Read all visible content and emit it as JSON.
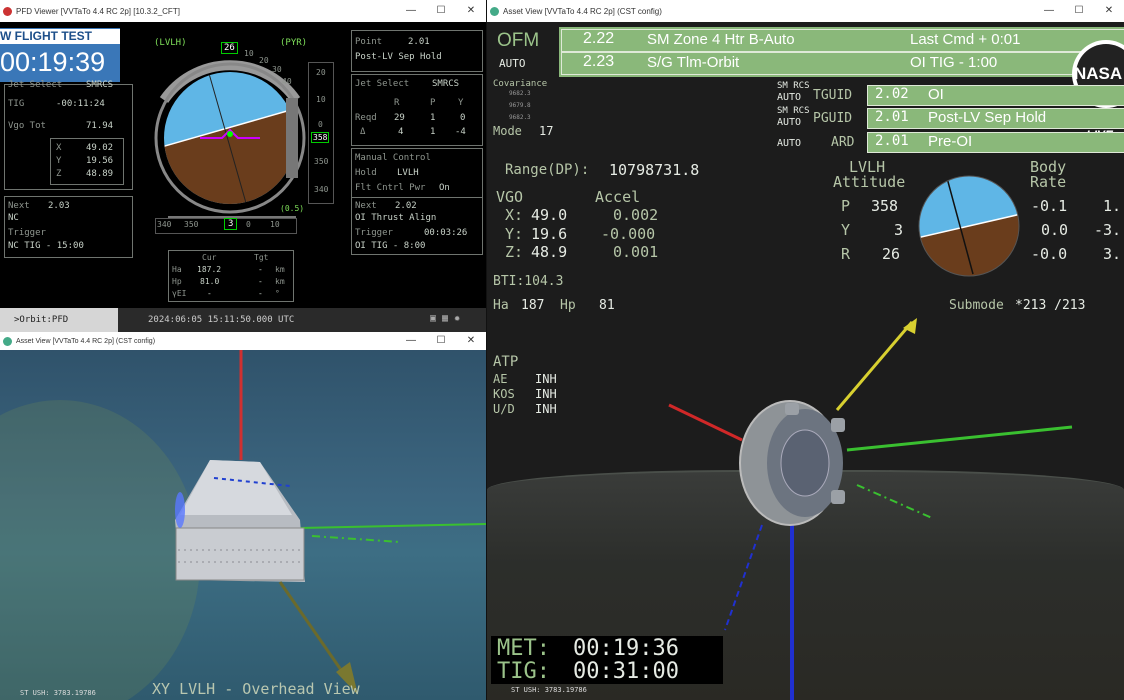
{
  "pfd": {
    "title": "PFD Viewer [VVTaTo 4.4 RC 2p] [10.3.2_CFT]",
    "controls": {
      "min": "—",
      "max": "☐",
      "close": "✕"
    },
    "banner": {
      "label": "W FLIGHT TEST",
      "timer": "00:19:39"
    },
    "left": {
      "jet_select_label": "Jet Select",
      "jet_select_value": "SMRCS",
      "tig_label": "TIG",
      "tig_value": "-00:11:24",
      "vgo_label": "Vgo Tot",
      "vgo_value": "71.94",
      "x_label": "X",
      "x_value": "49.02",
      "y_label": "Y",
      "y_value": "19.56",
      "z_label": "Z",
      "z_value": "48.89",
      "next_label": "Next",
      "next_value": "2.03",
      "next_name": "NC",
      "trigger_label": "Trigger",
      "trigger_value": "NC TIG - 15:00"
    },
    "attitude": {
      "lvlh": "(LVLH)",
      "pyr": "(PYR)",
      "roll_value": "26",
      "pitch_scale": [
        "20",
        "10",
        "0",
        "350",
        "340"
      ],
      "pitch_value": "358",
      "yaw_scale": [
        "340",
        "350",
        "0",
        "10"
      ],
      "yaw_value": "3",
      "roll_scale": [
        "10",
        "20",
        "30",
        "40"
      ],
      "rate_tag": "(0.5)"
    },
    "right": {
      "point_label": "Point",
      "point_value": "2.01",
      "point_name": "Post-LV Sep Hold",
      "jet_select_label": "Jet Select",
      "jet_select_value": "SMRCS",
      "r_label": "R",
      "p_label": "P",
      "y_label": "Y",
      "reqd_label": "Reqd",
      "reqd_r": "29",
      "reqd_p": "1",
      "reqd_y": "0",
      "delta_label": "Δ",
      "delta_r": "4",
      "delta_p": "1",
      "delta_y": "-4",
      "manual_label": "Manual Control",
      "hold_label": "Hold",
      "hold_value": "LVLH",
      "flt_label": "Flt Cntrl Pwr",
      "flt_value": "On",
      "next_label": "Next",
      "next_value": "2.02",
      "next_name": "OI Thrust Align",
      "trigger_label": "Trigger",
      "trigger_value": "00:03:26",
      "trigger_name": "OI TIG - 8:00"
    },
    "orbit": {
      "cur_label": "Cur",
      "tgt_label": "Tgt",
      "ha_label": "Ha",
      "ha_cur": "187.2",
      "ha_tgt": "-",
      "ha_unit": "km",
      "hp_label": "Hp",
      "hp_cur": "81.0",
      "hp_tgt": "-",
      "hp_unit": "km",
      "yei_label": "γEI",
      "yei_cur": "-",
      "yei_tgt": "-",
      "yei_unit": "°"
    },
    "footer": {
      "crumb": ">Orbit:PFD",
      "timestamp": "2024:06:05  15:11:50.000  UTC"
    }
  },
  "asset_left": {
    "title": "Asset View [VVTaTo 4.4 RC 2p] (CST config)",
    "caption": "XY LVLH - Overhead View",
    "st": "ST USH: 3783.19786"
  },
  "asset_right": {
    "title": "Asset View [VVTaTo 4.4 RC 2p] (CST config)",
    "ofm": "OFM",
    "auto": "AUTO",
    "rows": [
      {
        "code": "2.22",
        "name": "SM Zone 4 Htr B-Auto",
        "extra": "Last Cmd + 0:01"
      },
      {
        "code": "2.23",
        "name": "S/G Tlm-Orbit",
        "extra": "OI TIG - 1:00"
      }
    ],
    "covariance": "Covariance",
    "cov_vals": [
      "9682.3",
      "9679.8",
      "9682.3"
    ],
    "mode_label": "Mode",
    "mode_value": "17",
    "guid": [
      {
        "prefix": "SM RCS",
        "auto": "AUTO",
        "key": "TGUID",
        "code": "2.02",
        "name": "OI"
      },
      {
        "prefix": "SM RCS",
        "auto": "AUTO",
        "key": "PGUID",
        "code": "2.01",
        "name": "Post-LV Sep Hold"
      },
      {
        "prefix": "",
        "auto": "AUTO",
        "key": "ARD",
        "code": "2.01",
        "name": "Pre-OI"
      }
    ],
    "range_label": "Range(DP):",
    "range_value": "10798731.8",
    "vgo_label": "VGO",
    "accel_label": "Accel",
    "vgo": [
      {
        "axis": "X:",
        "vgo": "49.0",
        "accel": "0.002"
      },
      {
        "axis": "Y:",
        "vgo": "19.6",
        "accel": "-0.000"
      },
      {
        "axis": "Z:",
        "vgo": "48.9",
        "accel": "0.001"
      }
    ],
    "lvlh_label": "LVLH",
    "attitude_label": "Attitude",
    "body_label": "Body",
    "rate_label": "Rate",
    "att": [
      {
        "axis": "P",
        "value": "358",
        "rate": "-0.1",
        "rate2": "1."
      },
      {
        "axis": "Y",
        "value": "3",
        "rate": "0.0",
        "rate2": "-3."
      },
      {
        "axis": "R",
        "value": "26",
        "rate": "-0.0",
        "rate2": "3."
      }
    ],
    "bti": "BTI:104.3",
    "ha_label": "Ha",
    "ha_value": "187",
    "hp_label": "Hp",
    "hp_value": "81",
    "submode_label": "Submode",
    "submode_value": "*213 /213",
    "atp_label": "ATP",
    "atp": [
      {
        "key": "AE",
        "value": "INH"
      },
      {
        "key": "KOS",
        "value": "INH"
      },
      {
        "key": "U/D",
        "value": "INH"
      }
    ],
    "met_label": "MET:",
    "met_value": "00:19:36",
    "tig_label": "TIG:",
    "tig_value": "00:31:00",
    "st": "ST USH: 3783.19786",
    "nasa": "NASA",
    "live": "LIVE"
  }
}
